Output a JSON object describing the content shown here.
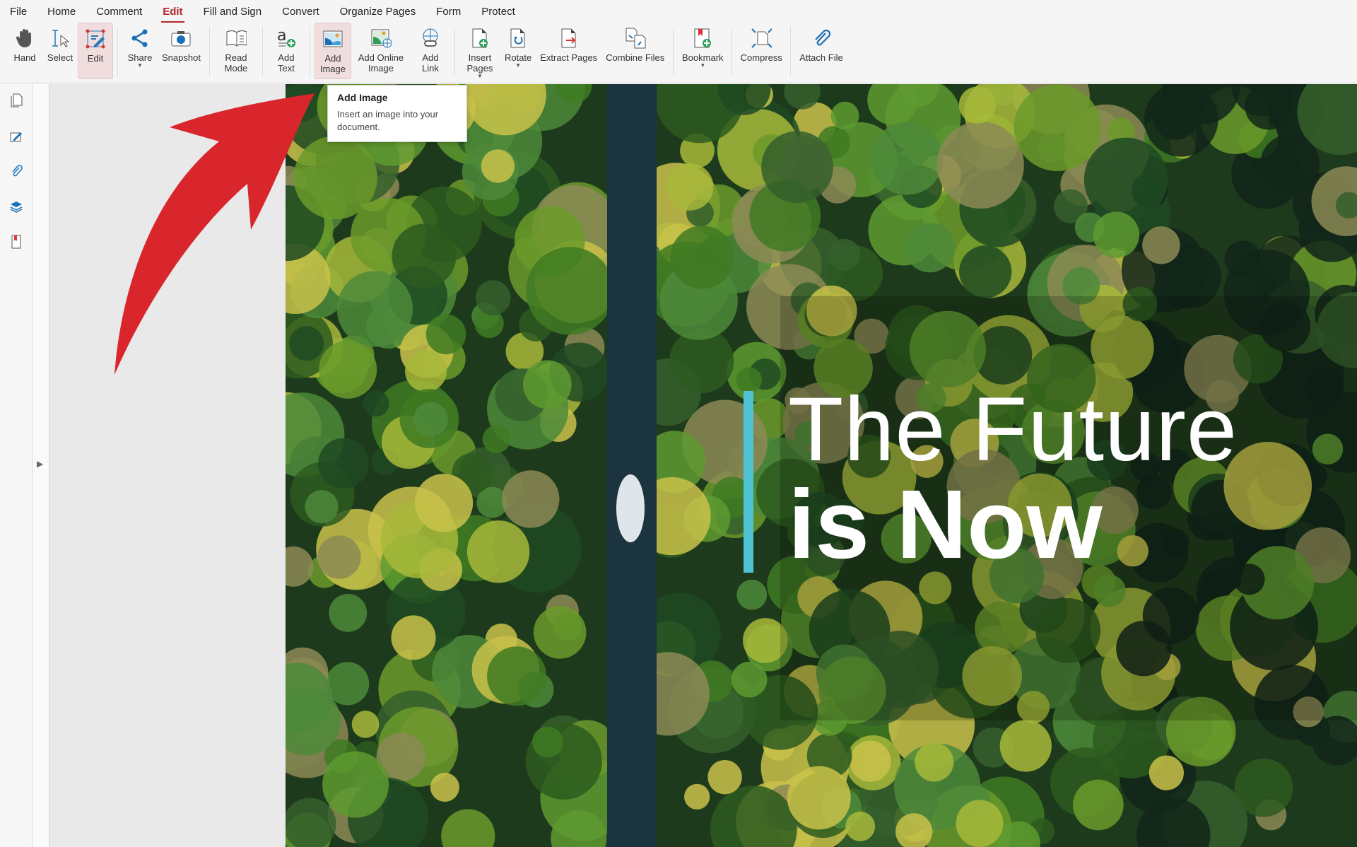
{
  "menu": [
    "File",
    "Home",
    "Comment",
    "Edit",
    "Fill and Sign",
    "Convert",
    "Organize Pages",
    "Form",
    "Protect"
  ],
  "toolbar": {
    "hand": "Hand",
    "select": "Select",
    "edit": "Edit",
    "share": "Share",
    "snapshot": "Snapshot",
    "read_mode": "Read Mode",
    "add_text": "Add Text",
    "add_image": "Add Image",
    "add_online_image": "Add Online Image",
    "add_link": "Add Link",
    "insert_pages": "Insert Pages",
    "rotate": "Rotate",
    "extract_pages": "Extract Pages",
    "combine_files": "Combine Files",
    "bookmark": "Bookmark",
    "compress": "Compress",
    "attach_file": "Attach File"
  },
  "tooltip": {
    "title": "Add Image",
    "description": "Insert an image into your document."
  },
  "document": {
    "line1": "The Future",
    "line2": "is Now"
  },
  "colors": {
    "accent": "#b3262e",
    "arrow": "#d8262c",
    "bar": "#4fc3d4"
  }
}
